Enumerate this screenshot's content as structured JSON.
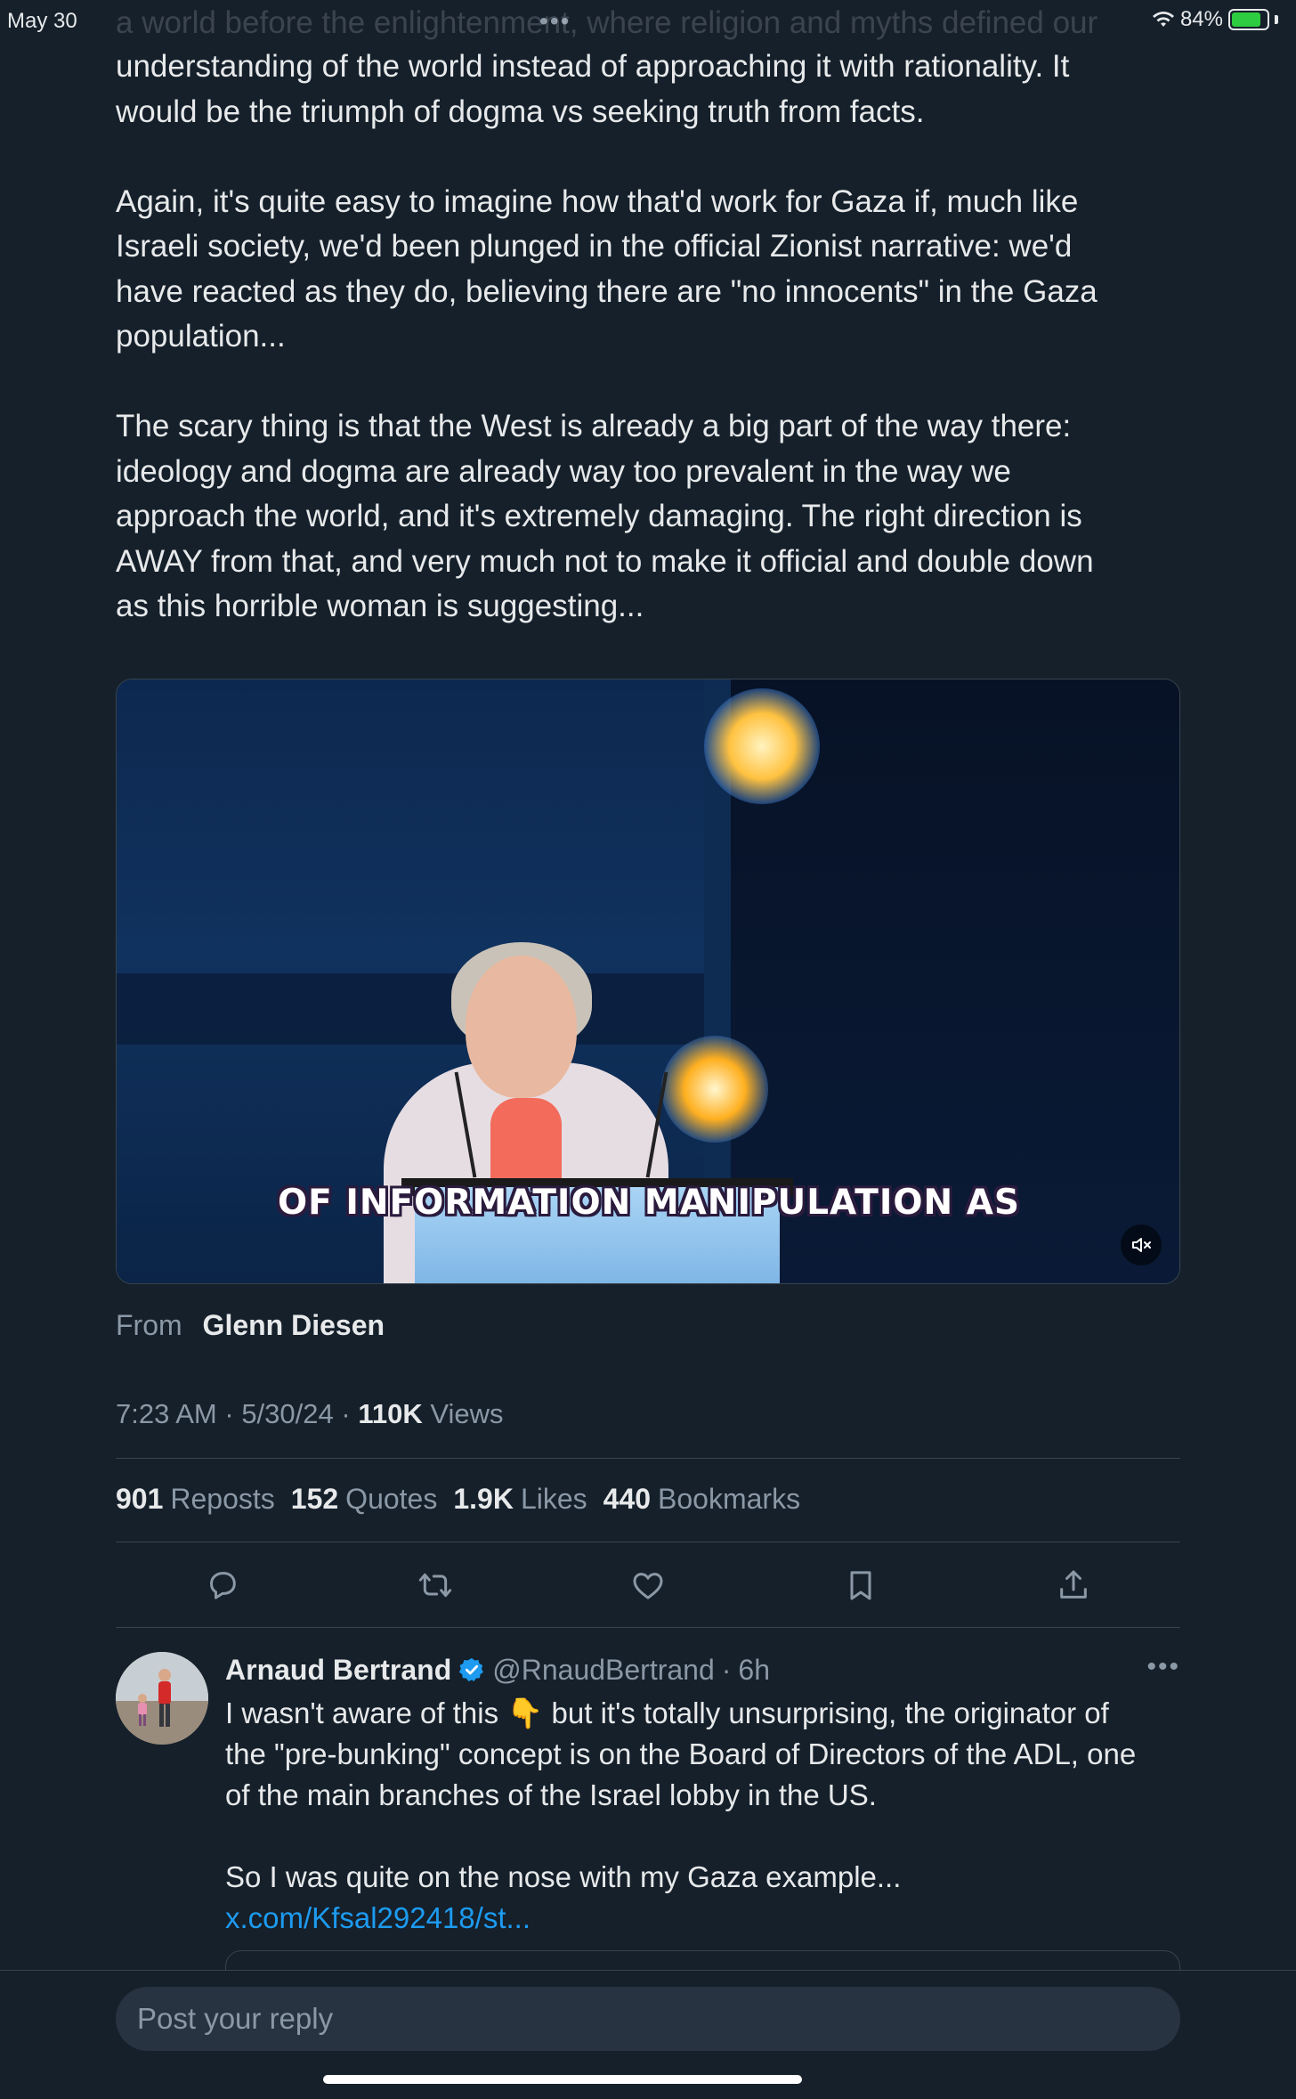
{
  "status_bar": {
    "date": "May 30",
    "dots": "•••",
    "battery_percent": "84%",
    "battery_level": 0.84
  },
  "tweet": {
    "faded_line": "a world before the enlightenment, where religion and myths defined our",
    "paragraphs": [
      "understanding of the world instead of approaching it with rationality. It\nwould be the triumph of dogma vs seeking truth from facts.",
      "Again, it's quite easy to imagine how that'd work for Gaza if, much like\nIsraeli society, we'd been plunged in the official Zionist narrative: we'd\nhave reacted as they do, believing there are \"no innocents\" in the Gaza\npopulation...",
      "The scary thing is that the West is already a big part of the way there:\nideology and dogma are already way too prevalent in the way we\napproach the world, and it's extremely damaging. The right direction is\nAWAY from that, and very much not to make it official and double down\nas this horrible woman is suggesting..."
    ],
    "video": {
      "caption": "OF INFORMATION MANIPULATION AS",
      "mute_icon": "speaker-muted-icon"
    },
    "from_label": "From",
    "from_name": "Glenn Diesen",
    "time": "7:23 AM",
    "date": "5/30/24",
    "views_count": "110K",
    "views_label": "Views",
    "stats": {
      "reposts_count": "901",
      "reposts_label": "Reposts",
      "quotes_count": "152",
      "quotes_label": "Quotes",
      "likes_count": "1.9K",
      "likes_label": "Likes",
      "bookmarks_count": "440",
      "bookmarks_label": "Bookmarks"
    },
    "actions": [
      "reply-icon",
      "repost-icon",
      "like-icon",
      "bookmark-icon",
      "share-icon"
    ]
  },
  "reply": {
    "name": "Arnaud Bertrand",
    "handle": "@RnaudBertrand",
    "time": "6h",
    "text": "I wasn't aware of this 👇 but it's totally unsurprising, the originator of\nthe \"pre-bunking\" concept is on the Board of Directors of the ADL, one\nof the main branches of the Israel lobby in the US.\n\nSo I was quite on the nose with my Gaza example...",
    "link": "x.com/Kfsal292418/st..."
  },
  "composer": {
    "placeholder": "Post your reply"
  },
  "colors": {
    "background": "#15202b",
    "accent": "#1d9bf0",
    "muted_text": "#8b98a5",
    "text": "#e7e9ea",
    "border": "#38444d"
  }
}
